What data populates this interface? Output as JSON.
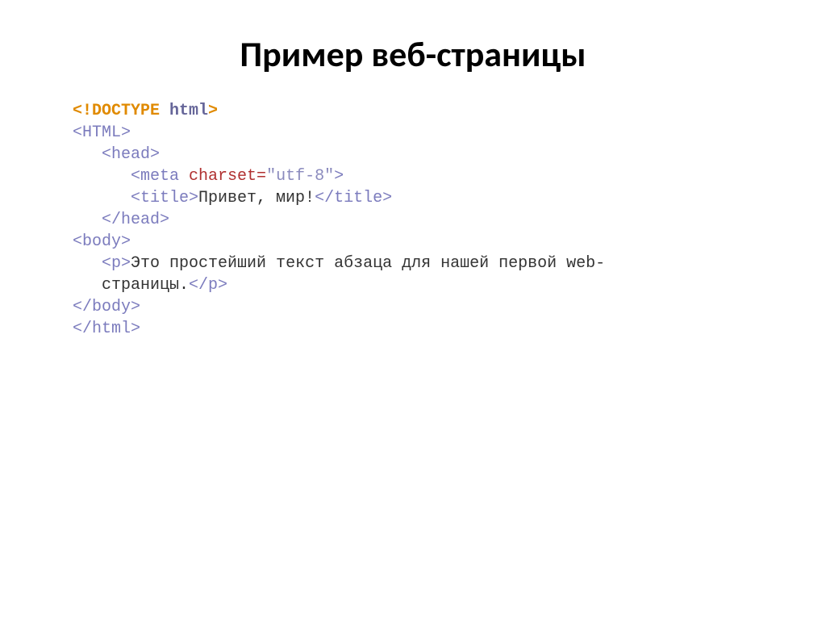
{
  "slide": {
    "title": "Пример веб-страницы"
  },
  "code": {
    "doctype_open": "<!DOCTYPE",
    "doctype_html": " html",
    "doctype_close": ">",
    "html_open": "<HTML>",
    "head_open": "<head>",
    "meta_open": "<meta",
    "meta_attr_sp": " ",
    "meta_attr_name": "charset=",
    "meta_attr_value": "\"utf-8\"",
    "meta_close": ">",
    "title_open": "<title>",
    "title_text": "Привет, мир!",
    "title_close": "</title>",
    "head_close": "</head>",
    "body_open": "<body>",
    "p_open": "<p>",
    "p_text_line1": "Это простейший текст абзаца для нашей первой web-",
    "p_text_line2": "страницы.",
    "p_close": "</p>",
    "body_close": "</body>",
    "html_close": "</html>"
  }
}
